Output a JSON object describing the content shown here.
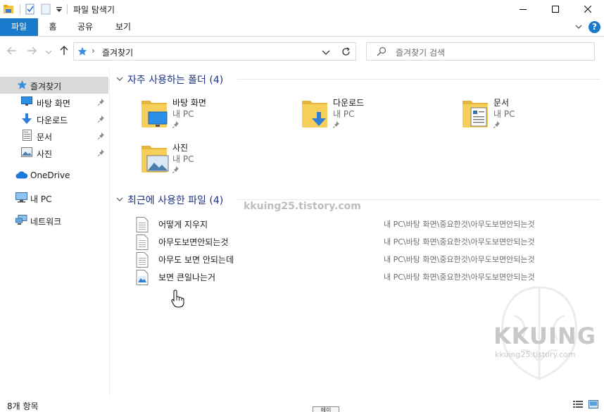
{
  "window": {
    "title": "파일 탐색기"
  },
  "ribbon": {
    "tabs": [
      {
        "label": "파일",
        "active": true
      },
      {
        "label": "홈"
      },
      {
        "label": "공유"
      },
      {
        "label": "보기"
      }
    ],
    "help": "?"
  },
  "address": {
    "crumb": "즐겨찾기",
    "search_placeholder": "즐겨찾기 검색"
  },
  "nav": {
    "items": [
      {
        "label": "즐겨찾기",
        "icon": "star-icon",
        "selected": true
      },
      {
        "label": "바탕 화면",
        "icon": "desktop-icon",
        "pinned": true
      },
      {
        "label": "다운로드",
        "icon": "download-icon",
        "pinned": true
      },
      {
        "label": "문서",
        "icon": "document-icon",
        "pinned": true
      },
      {
        "label": "사진",
        "icon": "pictures-icon",
        "pinned": true
      },
      {
        "label": "OneDrive",
        "icon": "cloud-icon"
      },
      {
        "label": "내 PC",
        "icon": "computer-icon"
      },
      {
        "label": "네트워크",
        "icon": "network-icon"
      }
    ]
  },
  "frequent": {
    "header": "자주 사용하는 폴더 (4)",
    "folders": [
      {
        "name": "바탕 화면",
        "location": "내 PC",
        "icon": "desktop-folder-icon"
      },
      {
        "name": "다운로드",
        "location": "내 PC",
        "icon": "download-folder-icon"
      },
      {
        "name": "문서",
        "location": "내 PC",
        "icon": "document-folder-icon"
      },
      {
        "name": "사진",
        "location": "내 PC",
        "icon": "pictures-folder-icon"
      }
    ]
  },
  "recent": {
    "header": "최근에 사용한 파일 (4)",
    "files": [
      {
        "name": "어떻게 지우지",
        "path": "내 PC\\바탕 화면\\중요한것\\아무도보면안되는것",
        "icon": "text-file-icon"
      },
      {
        "name": "아무도보면안되는것",
        "path": "내 PC\\바탕 화면\\중요한것\\아무도보면안되는것",
        "icon": "text-file-icon"
      },
      {
        "name": "아무도 보면 안되는데",
        "path": "내 PC\\바탕 화면\\중요한것\\아무도보면안되는것",
        "icon": "text-file-icon"
      },
      {
        "name": "보면 큰일나는거",
        "path": "내 PC\\바탕 화면\\중요한것\\아무도보면안되는것",
        "icon": "image-file-icon"
      }
    ]
  },
  "status": {
    "count": "8개 항목",
    "tooltip": "메이"
  },
  "watermark": {
    "center": "kkuing25.tistory.com",
    "logo": "KKUING",
    "logo_sub": "kkuing25.tistory.com"
  },
  "colors": {
    "accent": "#1979ca",
    "group_header": "#1e3287",
    "folder": "#f4c542",
    "selected_nav": "#d9d9d9"
  }
}
